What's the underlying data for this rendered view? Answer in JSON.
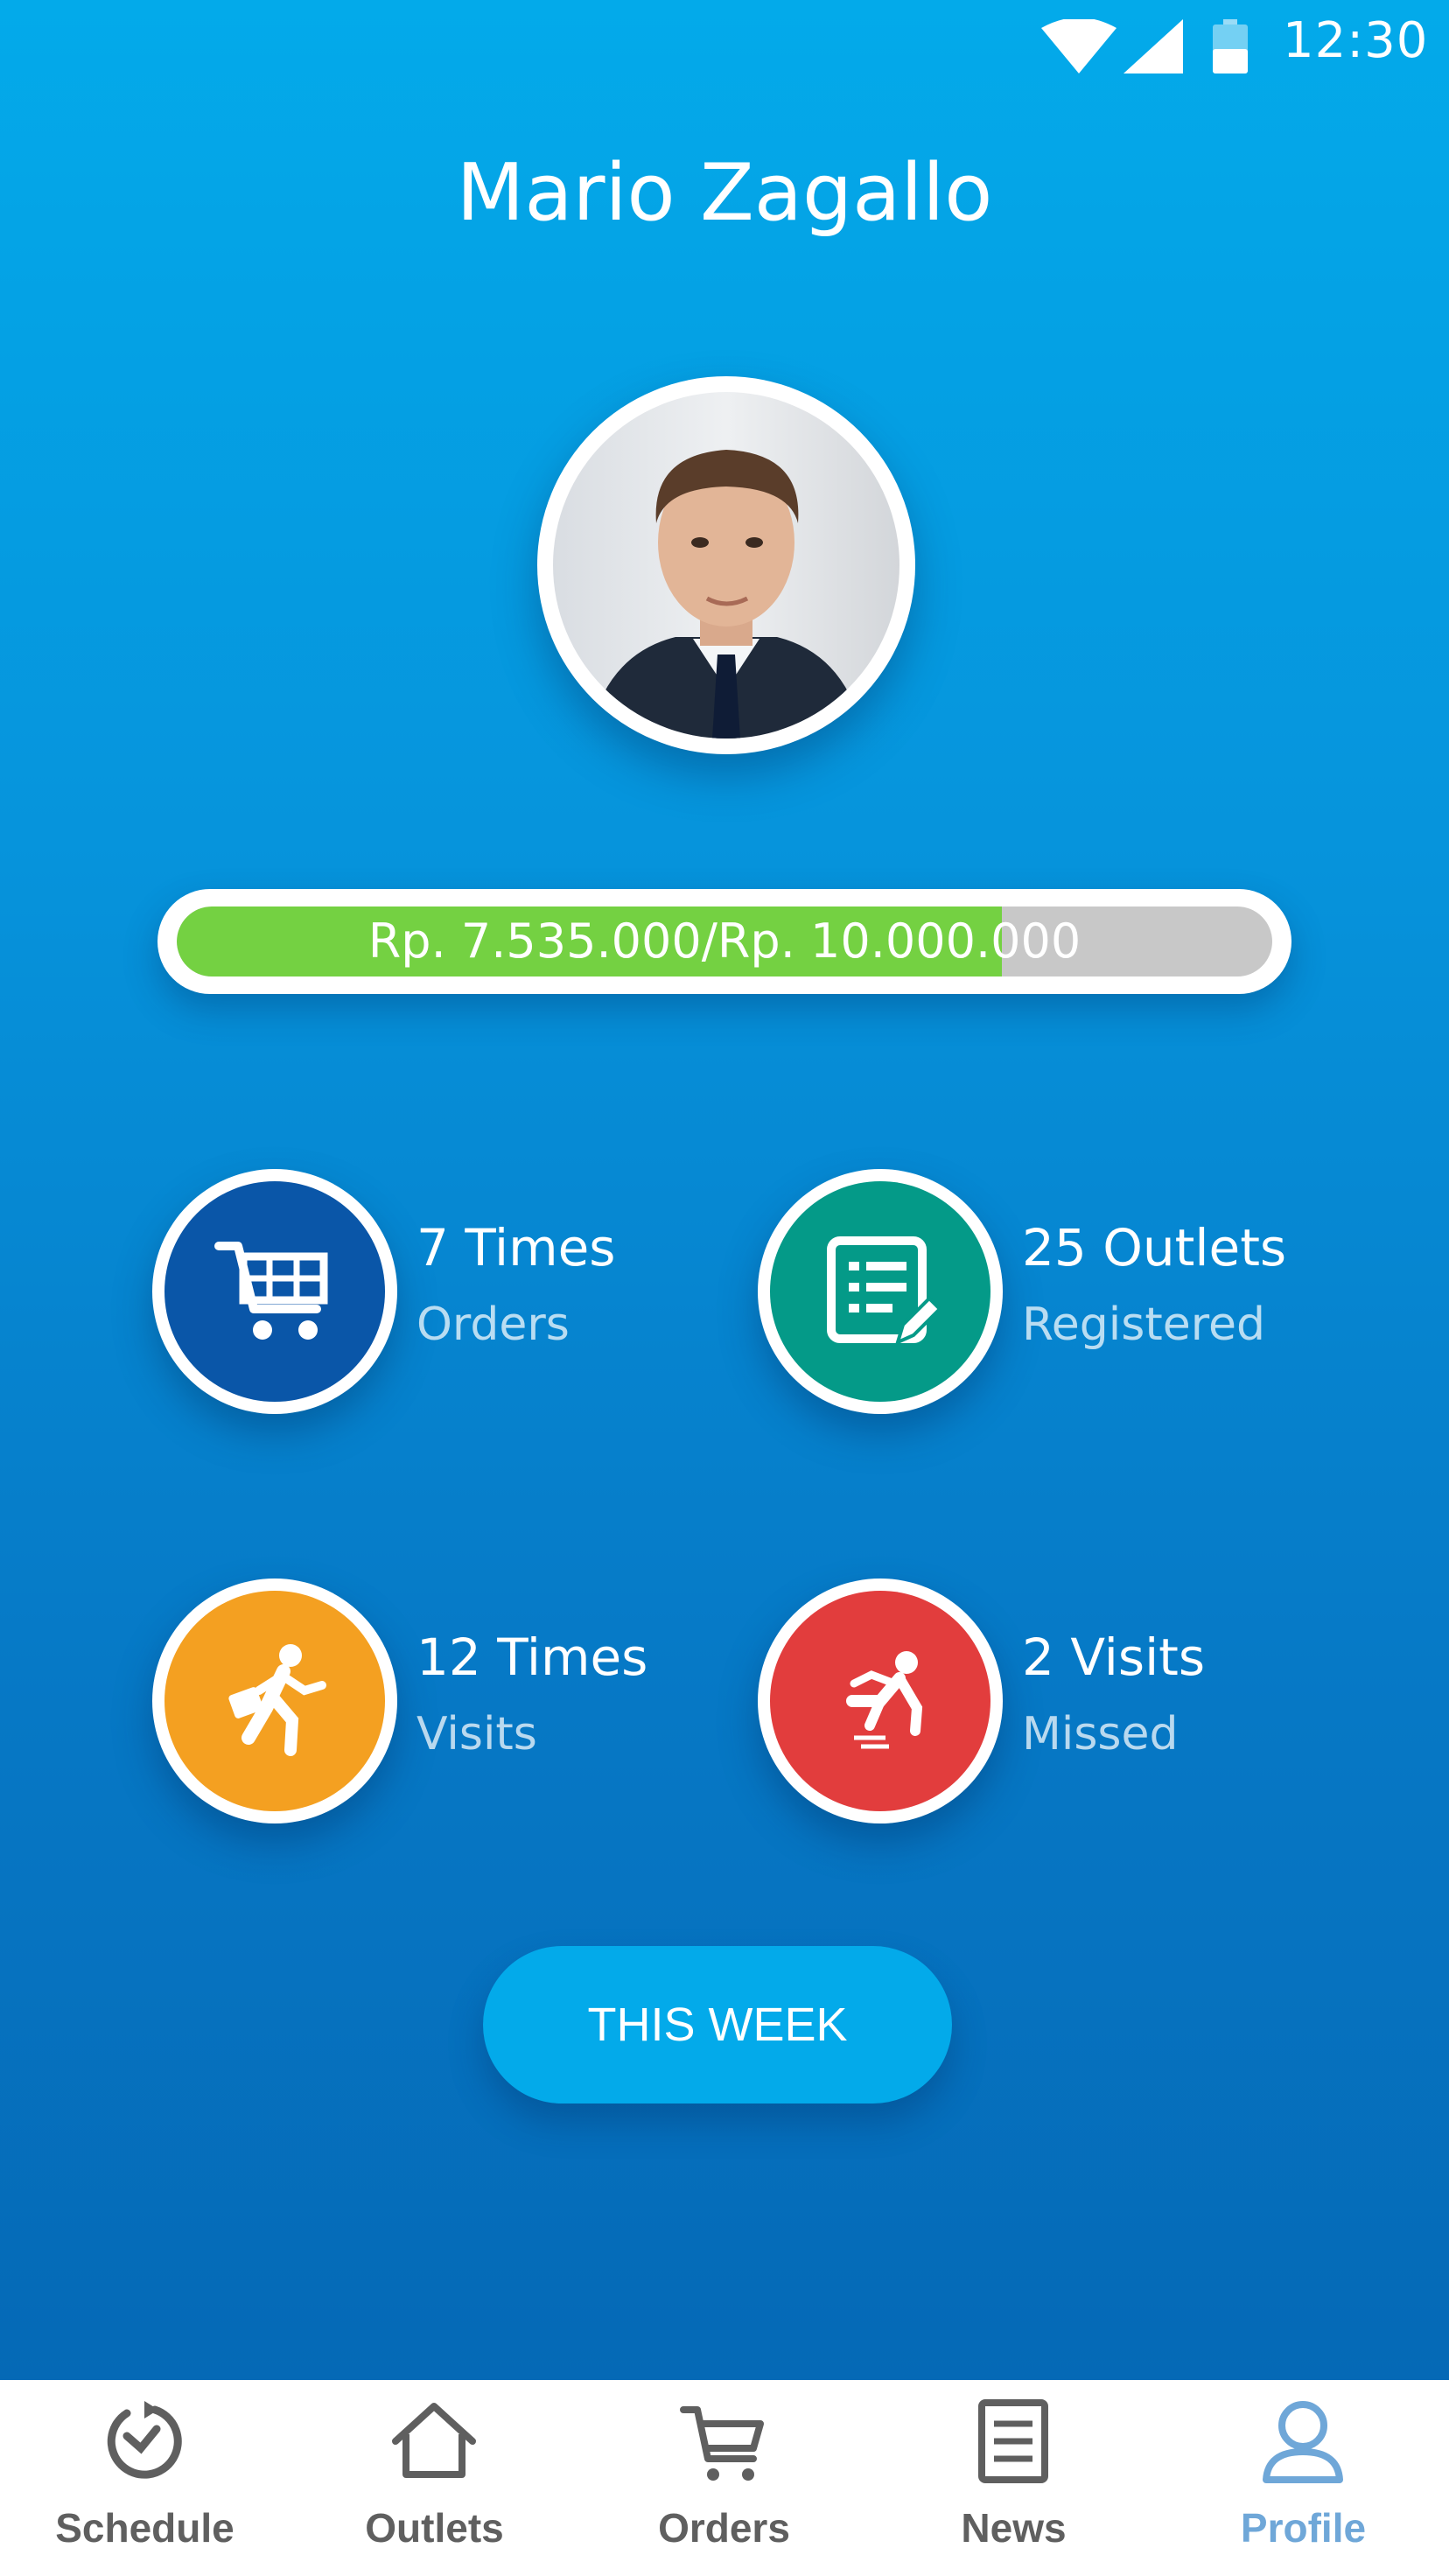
{
  "status_bar": {
    "time": "12:30",
    "icons": [
      "wifi-icon",
      "signal-icon",
      "battery-icon"
    ]
  },
  "profile": {
    "name": "Mario Zagallo"
  },
  "progress": {
    "label": "Rp. 7.535.000/Rp. 10.000.000",
    "current": 7535000,
    "target": 10000000,
    "fraction": 0.7535
  },
  "stats": [
    {
      "value": "7 Times",
      "label": "Orders",
      "icon": "shopping-cart-icon",
      "color": "#0a56a8"
    },
    {
      "value": "25 Outlets",
      "label": "Registered",
      "icon": "form-edit-icon",
      "color": "#049a88"
    },
    {
      "value": "12 Times",
      "label": "Visits",
      "icon": "walking-businessman-icon",
      "color": "#f4a021"
    },
    {
      "value": "2 Visits",
      "label": "Missed",
      "icon": "falling-person-icon",
      "color": "#e23d3d"
    }
  ],
  "period_button": "THIS WEEK",
  "nav": {
    "items": [
      {
        "label": "Schedule",
        "icon": "schedule-icon"
      },
      {
        "label": "Outlets",
        "icon": "home-icon"
      },
      {
        "label": "Orders",
        "icon": "cart-icon"
      },
      {
        "label": "News",
        "icon": "news-icon"
      },
      {
        "label": "Profile",
        "icon": "user-icon"
      }
    ],
    "active": "Profile",
    "active_color": "#6fa7d8",
    "inactive_color": "#5f5f5f"
  },
  "colors": {
    "background_top": "#03aaea",
    "background_bottom": "#0569b6",
    "progress_fill": "#74d142",
    "button": "#03aaea"
  }
}
